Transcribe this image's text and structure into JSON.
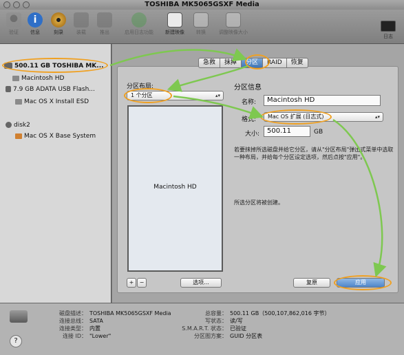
{
  "window": {
    "title": "TOSHIBA MK5065GSXF Media"
  },
  "toolbar": {
    "items": [
      {
        "label": "验证",
        "icon": "microscope-icon",
        "enabled": false
      },
      {
        "label": "信息",
        "icon": "info-icon",
        "enabled": true
      },
      {
        "label": "刻录",
        "icon": "burn-disc-icon",
        "enabled": true
      },
      {
        "label": "装载",
        "icon": "mount-icon",
        "enabled": false
      },
      {
        "label": "推出",
        "icon": "eject-icon",
        "enabled": false
      },
      {
        "label": "启用日志功能",
        "icon": "journal-icon",
        "enabled": false
      },
      {
        "label": "新建映像",
        "icon": "new-image-icon",
        "enabled": true
      },
      {
        "label": "转换",
        "icon": "convert-icon",
        "enabled": false
      },
      {
        "label": "调整映像大小",
        "icon": "resize-image-icon",
        "enabled": false
      }
    ],
    "log_label": "日志"
  },
  "sidebar": {
    "items": [
      {
        "label": "500.11 GB TOSHIBA MK...",
        "type": "disk",
        "selected": true
      },
      {
        "label": "Macintosh HD",
        "type": "volume"
      },
      {
        "label": "7.9 GB ADATA USB Flash...",
        "type": "disk"
      },
      {
        "label": "Mac OS X Install ESD",
        "type": "volume"
      },
      {
        "label": "disk2",
        "type": "disk"
      },
      {
        "label": "Mac OS X Base System",
        "type": "volume"
      }
    ]
  },
  "tabs": [
    {
      "label": "急救",
      "active": false
    },
    {
      "label": "抹掉",
      "active": false
    },
    {
      "label": "分区",
      "active": true
    },
    {
      "label": "RAID",
      "active": false
    },
    {
      "label": "恢复",
      "active": false
    }
  ],
  "partition": {
    "layout_label": "分区布局:",
    "layout_value": "1 个分区",
    "info_label": "分区信息",
    "name_label": "名称:",
    "name_value": "Macintosh HD",
    "format_label": "格式:",
    "format_value": "Mac OS 扩展 (日志式)",
    "size_label": "大小:",
    "size_value": "500.11",
    "size_unit": "GB",
    "help_text": "若要抹掉所选磁盘并给它分区，请从\"分区布局\"弹出式菜单中选取一种布局，并给每个分区设定选项，然后点按\"应用\"。",
    "status_text": "所选分区将被创建。",
    "map_partition_label": "Macintosh HD",
    "add_label": "+",
    "remove_label": "−",
    "options_label": "选项...",
    "revert_label": "复原",
    "apply_label": "应用"
  },
  "info": {
    "left": [
      {
        "key": "磁盘描述：",
        "value": "TOSHIBA MK5065GSXF Media"
      },
      {
        "key": "连接总线：",
        "value": "SATA"
      },
      {
        "key": "连接类型：",
        "value": "内置"
      },
      {
        "key": "连接 ID：",
        "value": "\"Lower\""
      }
    ],
    "right": [
      {
        "key": "总容量：",
        "value": "500.11 GB（500,107,862,016 字节）"
      },
      {
        "key": "写状态：",
        "value": "读/写"
      },
      {
        "key": "S.M.A.R.T. 状态：",
        "value": "已验证"
      },
      {
        "key": "分区图方案：",
        "value": "GUID 分区表"
      }
    ]
  },
  "colors": {
    "highlight_ring": "#f0a020",
    "annotation_arrow": "#7ec850",
    "selected_tab": "#3e74b6"
  }
}
